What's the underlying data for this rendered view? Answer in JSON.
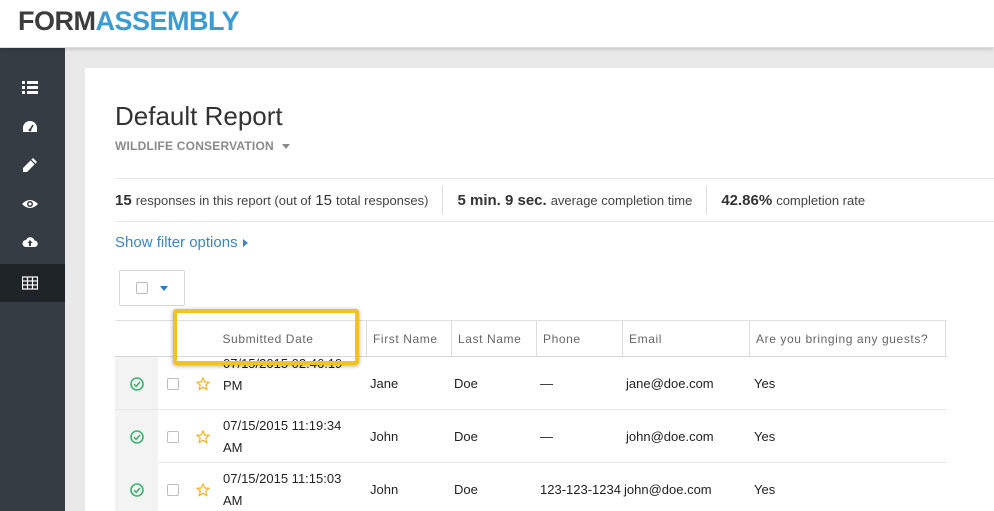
{
  "brand": {
    "part1": "FORM",
    "part2": "ASSEMBLY"
  },
  "sidebar": {
    "items": [
      {
        "icon": "list-icon"
      },
      {
        "icon": "dashboard-icon"
      },
      {
        "icon": "pencil-icon"
      },
      {
        "icon": "eye-icon"
      },
      {
        "icon": "cloud-upload-icon"
      },
      {
        "icon": "table-icon",
        "active": true
      }
    ]
  },
  "report": {
    "title": "Default Report",
    "form_name": "WILDLIFE CONSERVATION"
  },
  "stats": {
    "responses_count": "15",
    "responses_mid": "responses in this report (out of",
    "total_count": "15",
    "total_suffix": "total responses)",
    "avg_time": "5 min. 9 sec.",
    "avg_label": "average completion time",
    "completion_pct": "42.86%",
    "completion_label": "completion rate"
  },
  "filter": {
    "label": "Show filter options"
  },
  "columns": {
    "submitted": "Submitted Date",
    "first": "First Name",
    "last": "Last Name",
    "phone": "Phone",
    "email": "Email",
    "guests": "Are you bringing any guests?"
  },
  "rows": [
    {
      "date1": "07/15/2015 02:46:19",
      "date2": "PM",
      "first": "Jane",
      "last": "Doe",
      "phone": "—",
      "email": "jane@doe.com",
      "guests": "Yes"
    },
    {
      "date1": "07/15/2015 11:19:34",
      "date2": "AM",
      "first": "John",
      "last": "Doe",
      "phone": "—",
      "email": "john@doe.com",
      "guests": "Yes"
    },
    {
      "date1": "07/15/2015 11:15:03",
      "date2": "AM",
      "first": "John",
      "last": "Doe",
      "phone": "123-123-1234",
      "email": "john@doe.com",
      "guests": "Yes"
    }
  ],
  "colors": {
    "accent": "#3b84c4",
    "brand_blue": "#3b9bd3",
    "highlight": "#f5c11c",
    "check_green": "#3cb371",
    "star": "#f0b323"
  }
}
